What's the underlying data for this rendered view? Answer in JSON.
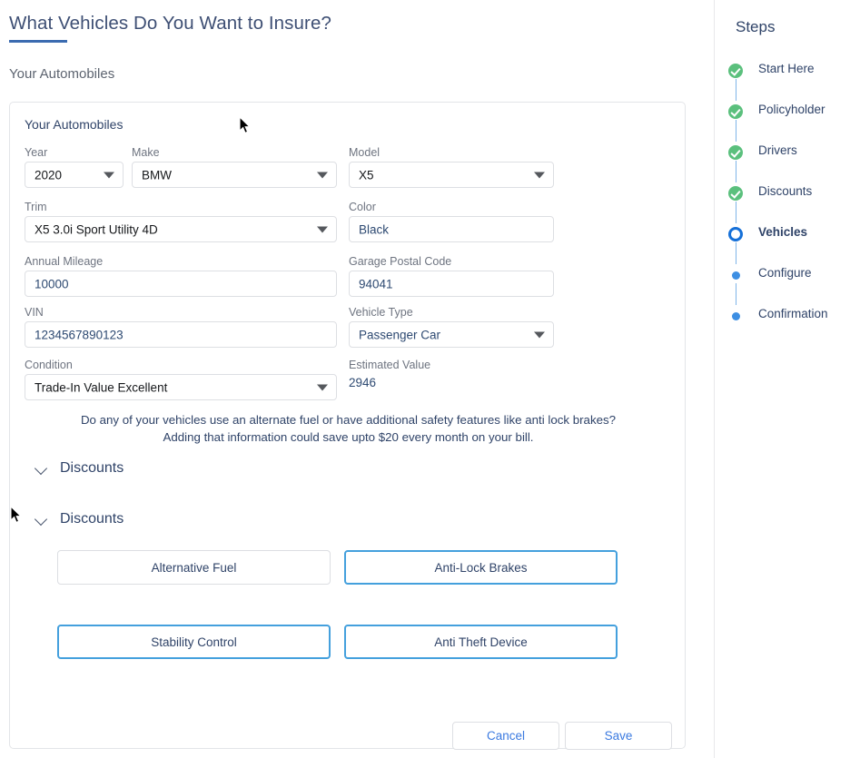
{
  "page": {
    "title": "What Vehicles Do You Want to Insure?",
    "subtitle": "Your Automobiles",
    "accent_color": "#3b6bb0",
    "title_color": "#3e4f74"
  },
  "card": {
    "heading": "Your Automobiles",
    "fields": [
      {
        "label": "Year",
        "value": "2020",
        "type": "select",
        "value_color": "dark"
      },
      {
        "label": "Make",
        "value": "BMW",
        "type": "select",
        "value_color": "dark"
      },
      {
        "label": "Model",
        "value": "X5",
        "type": "select",
        "value_color": "dark"
      },
      {
        "label": "Trim",
        "value": "X5 3.0i Sport Utility 4D",
        "type": "select",
        "value_color": "dark"
      },
      {
        "label": "Color",
        "value": "Black",
        "type": "text",
        "value_color": "blue"
      },
      {
        "label": "Annual Mileage",
        "value": "10000",
        "type": "text",
        "value_color": "blue"
      },
      {
        "label": "Garage Postal Code",
        "value": "94041",
        "type": "text",
        "value_color": "blue"
      },
      {
        "label": "VIN",
        "value": "1234567890123",
        "type": "text",
        "value_color": "blue"
      },
      {
        "label": "Vehicle Type",
        "value": "Passenger Car",
        "type": "select",
        "value_color": "blue"
      },
      {
        "label": "Condition",
        "value": "Trade-In Value Excellent",
        "type": "select",
        "value_color": "dark"
      },
      {
        "label": "Estimated Value",
        "value": "2946",
        "type": "readonly",
        "value_color": "blue"
      }
    ],
    "info_line_1": "Do any of your vehicles use an alternate fuel or have additional safety features like anti lock brakes?",
    "info_line_2": "Adding that information could save upto $20 every month on your bill.",
    "discount_sections": [
      {
        "title": "Discounts",
        "expanded": true
      },
      {
        "title": "Discounts",
        "expanded": true
      }
    ],
    "discount_options": [
      {
        "label": "Alternative Fuel",
        "selected": false
      },
      {
        "label": "Anti-Lock Brakes",
        "selected": true
      },
      {
        "label": "Stability Control",
        "selected": true
      },
      {
        "label": "Anti Theft Device",
        "selected": true
      }
    ],
    "footer": {
      "cancel_label": "Cancel",
      "save_label": "Save"
    }
  },
  "steps_panel": {
    "title": "Steps",
    "steps": [
      {
        "label": "Start Here",
        "state": "done"
      },
      {
        "label": "Policyholder",
        "state": "done"
      },
      {
        "label": "Drivers",
        "state": "done"
      },
      {
        "label": "Discounts",
        "state": "done"
      },
      {
        "label": "Vehicles",
        "state": "current"
      },
      {
        "label": "Configure",
        "state": "todo"
      },
      {
        "label": "Confirmation",
        "state": "todo"
      }
    ],
    "done_color": "#5bc07d",
    "current_color": "#1570d8",
    "todo_color": "#3d8fe3"
  }
}
